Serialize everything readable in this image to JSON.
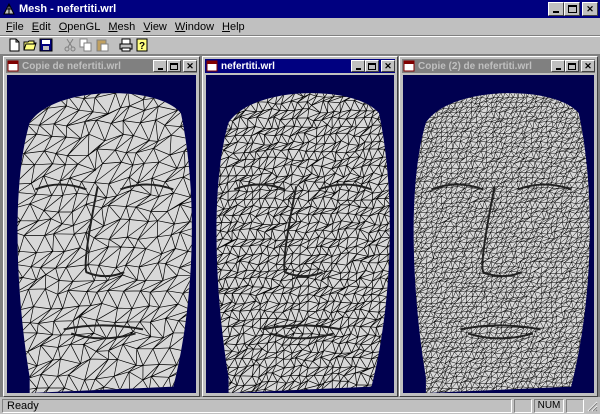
{
  "window": {
    "title": "Mesh - nefertiti.wrl",
    "icon": "mesh-app-icon",
    "controls": [
      "minimize-icon",
      "maximize-icon",
      "close-icon"
    ]
  },
  "menu": [
    {
      "label": "File",
      "underline": "F",
      "rest": "ile"
    },
    {
      "label": "Edit",
      "underline": "E",
      "rest": "dit"
    },
    {
      "label": "OpenGL",
      "underline": "O",
      "rest": "penGL"
    },
    {
      "label": "Mesh",
      "underline": "M",
      "rest": "esh"
    },
    {
      "label": "View",
      "underline": "V",
      "rest": "iew"
    },
    {
      "label": "Window",
      "underline": "W",
      "rest": "indow"
    },
    {
      "label": "Help",
      "underline": "H",
      "rest": "elp"
    }
  ],
  "toolbar": {
    "buttons": [
      "new-file-icon",
      "open-folder-icon",
      "save-disk-icon",
      "cut-icon",
      "copy-icon",
      "paste-icon",
      "print-icon",
      "help-icon"
    ]
  },
  "documents": [
    {
      "title": "Copie de nefertiti.wrl",
      "active": false,
      "mesh_density": "coarse"
    },
    {
      "title": "nefertiti.wrl",
      "active": true,
      "mesh_density": "medium"
    },
    {
      "title": "Copie (2) de nefertiti.wrl",
      "active": false,
      "mesh_density": "fine"
    }
  ],
  "colors": {
    "viewport_background": "#000050",
    "active_title": "#000080",
    "inactive_title": "#808080",
    "mesh_surface": "#d8d8d8",
    "mesh_lines": "#000000"
  },
  "status": {
    "text": "Ready",
    "indicator_1": "",
    "indicator_num": "NUM",
    "indicator_3": ""
  }
}
